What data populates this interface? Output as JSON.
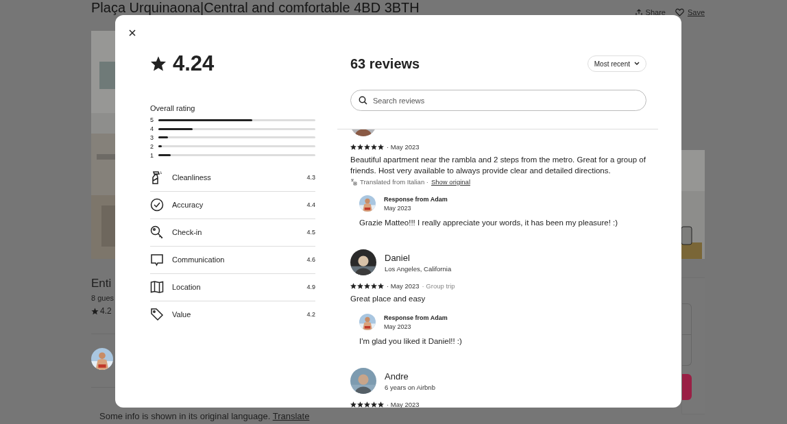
{
  "page": {
    "title": "Plaça Urquinaona|Central and comfortable 4BD 3BTH",
    "actions": [
      {
        "kind": "share",
        "label": "Share"
      },
      {
        "kind": "save",
        "label": "Save"
      }
    ],
    "listing": {
      "heading": "Enti",
      "guests": "8 gues",
      "rating": "4.2"
    },
    "notice": {
      "text": "Some info is shown in its original language.",
      "link": "Translate"
    }
  },
  "modal": {
    "rating": "4.24",
    "overall_label": "Overall rating",
    "distribution": [
      {
        "label": "5",
        "level": 0.6
      },
      {
        "label": "4",
        "level": 0.22
      },
      {
        "label": "3",
        "level": 0.06
      },
      {
        "label": "2",
        "level": 0.02
      },
      {
        "label": "1",
        "level": 0.08
      }
    ],
    "categories": [
      {
        "kind": "cleanliness",
        "label": "Cleanliness",
        "value": "4.3"
      },
      {
        "kind": "accuracy",
        "label": "Accuracy",
        "value": "4.4"
      },
      {
        "kind": "checkin",
        "label": "Check-in",
        "value": "4.5"
      },
      {
        "kind": "communication",
        "label": "Communication",
        "value": "4.6"
      },
      {
        "kind": "location",
        "label": "Location",
        "value": "4.9"
      },
      {
        "kind": "value",
        "label": "Value",
        "value": "4.2"
      }
    ],
    "reviews_title": "63 reviews",
    "sort": {
      "label": "Most recent"
    },
    "search": {
      "placeholder": "Search reviews"
    },
    "reviews": [
      {
        "stars": 5,
        "date": "· May 2023",
        "text": "Beautiful apartment near the rambla and 2 steps from the metro. Great for a group of friends. Host very available to always provide clear and detailed directions.",
        "translation": {
          "note": "Translated from Italian ·",
          "link": "Show original"
        },
        "response": {
          "author": "Response from Adam",
          "date": "May 2023",
          "text": "Grazie Matteo!!! I really appreciate your words, it has been my pleasure! :)"
        }
      },
      {
        "name": "Daniel",
        "subtitle": "Los Angeles, California",
        "stars": 5,
        "date": "· May 2023",
        "trip": "· Group trip",
        "text": "Great place and easy",
        "response": {
          "author": "Response from Adam",
          "date": "May 2023",
          "text": "I'm glad you liked it Daniel!! :)"
        }
      },
      {
        "name": "Andre",
        "subtitle": "6 years on Airbnb",
        "stars": 5,
        "date": "· May 2023"
      }
    ]
  }
}
